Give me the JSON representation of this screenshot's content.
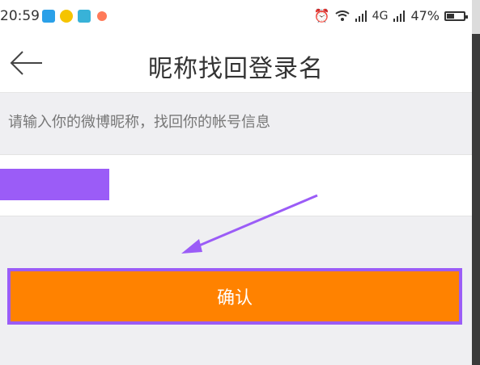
{
  "status_bar": {
    "time": "20:59",
    "network": "4G",
    "battery": "47%",
    "battery_level": 0.47,
    "icons": [
      "screenshot-icon",
      "app-icon",
      "keyboard-icon",
      "flower-icon",
      "alarm-icon",
      "wifi-icon",
      "signal-icon",
      "battery-icon"
    ]
  },
  "header": {
    "title": "昵称找回登录名",
    "back_icon": "back-arrow-icon"
  },
  "form": {
    "prompt": "请输入你的微博昵称，找回你的帐号信息",
    "nickname_value": "",
    "confirm_label": "确认"
  },
  "colors": {
    "accent": "#ff8200",
    "annotation": "#9b5cf7"
  }
}
